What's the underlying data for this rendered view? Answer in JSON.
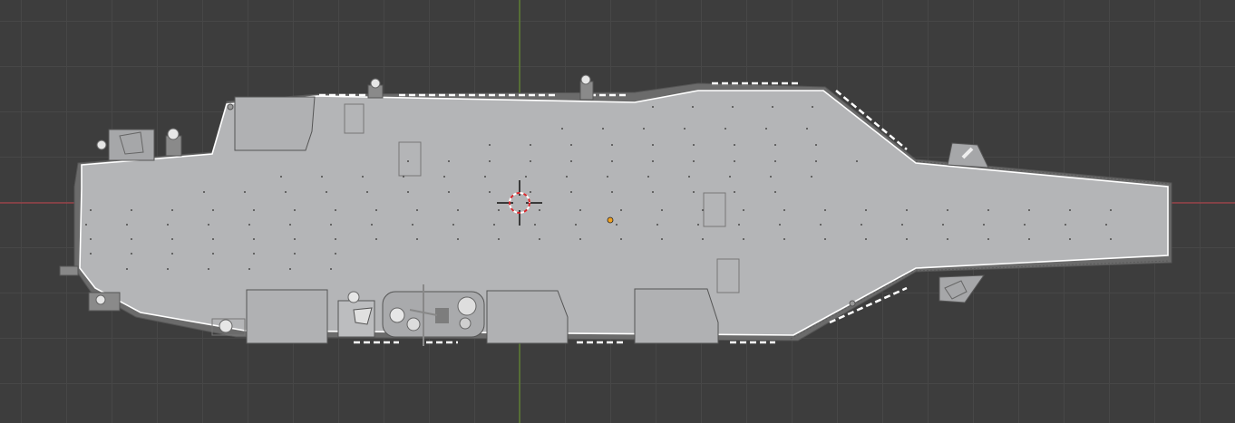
{
  "viewport": {
    "mode": "top-orthographic",
    "background": "#3d3d3d",
    "grid_color": "#474747",
    "x_axis_color": "#c0404a",
    "y_axis_color": "#6a9a2a"
  },
  "model": {
    "deck_color": "#b4b5b7",
    "hull_edge_color": "#6a6a6a",
    "outline_color": "#ffffff",
    "marking_color": "#ffffff",
    "dot_color": "#4a4a4a"
  },
  "cursor": {
    "ring_primary": "#ffffff",
    "ring_secondary": "#d6262b"
  },
  "origin": {
    "color": "#f0a020"
  }
}
